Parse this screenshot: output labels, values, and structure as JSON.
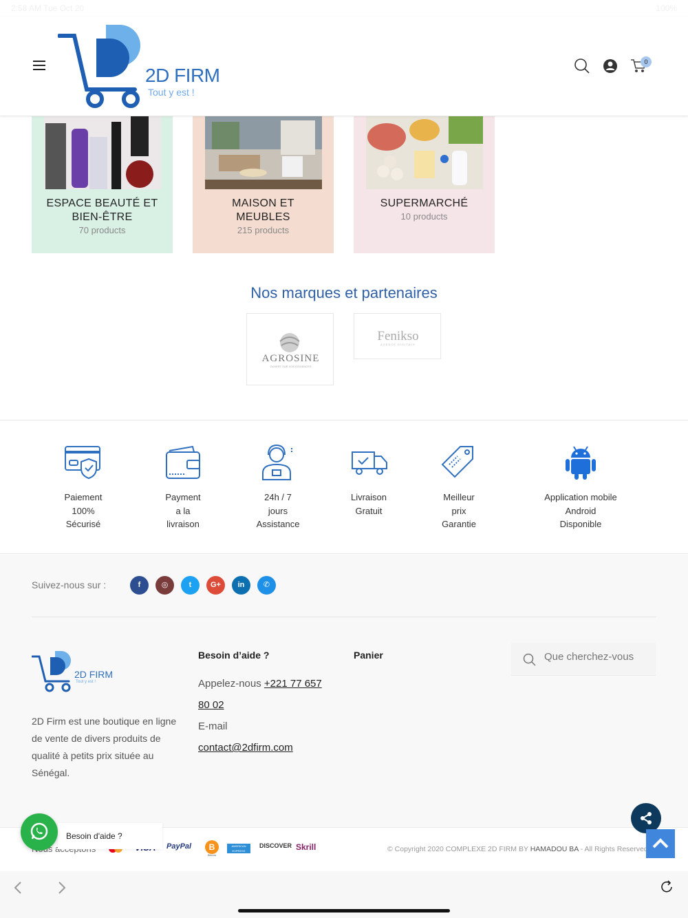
{
  "status_bar": {
    "time": "2:58 AM  Tue Oct 20",
    "battery": "100%"
  },
  "header": {
    "brand_name": "2D FIRM",
    "brand_tagline": "Tout y est !",
    "cart_count": "0"
  },
  "categories": [
    {
      "title_line1": "ESPACE BEAUTÉ ET",
      "title_line2": "BIEN-ÊTRE",
      "count": "70 products",
      "bg": "#d9f0e4"
    },
    {
      "title_line1": "MAISON ET",
      "title_line2": "MEUBLES",
      "count": "215 products",
      "bg": "#f4ddd0"
    },
    {
      "title_line1": "SUPERMARCHÉ",
      "title_line2": "",
      "count": "10 products",
      "bg": "#f6e5e8"
    }
  ],
  "brands": {
    "title": "Nos marques et partenaires",
    "items": [
      {
        "name": "AGROSINE",
        "sub": "OUVERT SUR VOS EXIGENCES"
      },
      {
        "name": "Fenikso",
        "sub": "AGENCE DIGITALE"
      }
    ]
  },
  "features": [
    {
      "icon": "secure-card-icon",
      "l1": "Paiement",
      "l2": "100%",
      "l3": "Sécurisé"
    },
    {
      "icon": "wallet-icon",
      "l1": "Payment",
      "l2": "a la",
      "l3": "livraison"
    },
    {
      "icon": "support-agent-icon",
      "l1": "24h / 7",
      "l2": "jours",
      "l3": "Assistance"
    },
    {
      "icon": "delivery-truck-icon",
      "l1": "Livraison",
      "l2": "Gratuit",
      "l3": ""
    },
    {
      "icon": "price-tag-icon",
      "l1": "Meilleur",
      "l2": "prix",
      "l3": "Garantie"
    },
    {
      "icon": "android-icon",
      "l1": "Application mobile",
      "l2": "Android",
      "l3": "Disponible"
    }
  ],
  "footer": {
    "follow_label": "Suivez-nous sur :",
    "social": [
      {
        "name": "facebook-icon",
        "glyph": "f",
        "color": "#2d4e91"
      },
      {
        "name": "instagram-icon",
        "glyph": "◎",
        "color": "#7a3b3b"
      },
      {
        "name": "twitter-icon",
        "glyph": "t",
        "color": "#1da1f2"
      },
      {
        "name": "google-plus-icon",
        "glyph": "G+",
        "color": "#dd4b39"
      },
      {
        "name": "linkedin-icon",
        "glyph": "in",
        "color": "#0b6fb0"
      },
      {
        "name": "whatsapp-icon",
        "glyph": "✆",
        "color": "#1e90e8"
      }
    ],
    "brand_name": "2D FIRM",
    "brand_tagline": "Tout y est !",
    "about": "2D Firm est une boutique en ligne de vente de divers produits de qualité à petits prix située au Sénégal.",
    "help_title": "Besoin d’aide ?",
    "call_label": "Appelez-nous",
    "phone_part1": "+221 77 657",
    "phone_part2": "80 02",
    "email_label": "E-mail",
    "email": "contact@2dfirm.com",
    "cart_title": "Panier",
    "search_placeholder": "Que cherchez-vous",
    "we_accept": "Nous acceptons",
    "payments": [
      "VISA",
      "PayPal",
      "Bitcoin",
      "AMERICAN EXPRESS",
      "DISCOVER",
      "Skrill"
    ],
    "copyright_pre": "© Copyright 2020 COMPLEXE 2D FIRM BY ",
    "copyright_name": "HAMADOU BA",
    "copyright_post": " - All Rights Reserved"
  },
  "whatsapp_help": "Besoin d'aide ?"
}
